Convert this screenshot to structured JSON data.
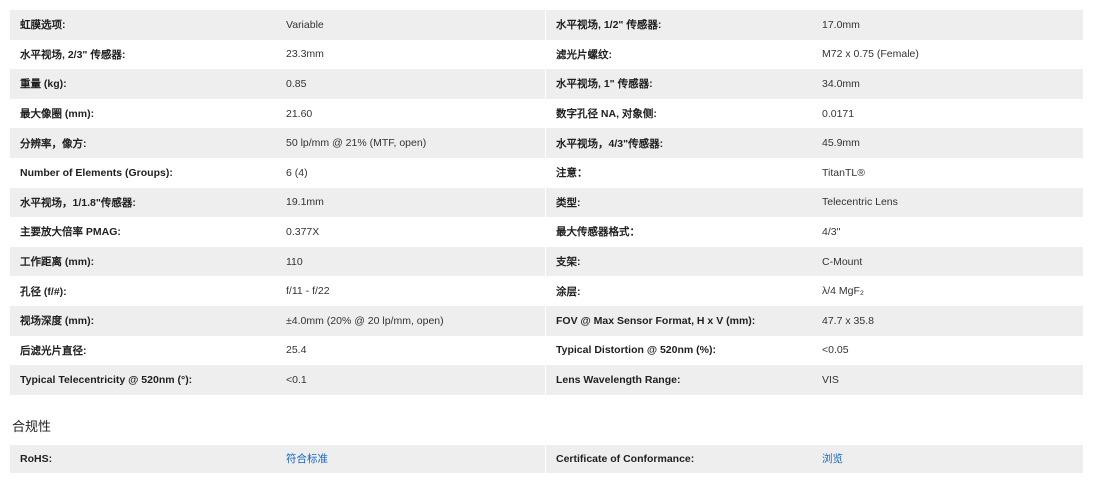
{
  "specs_left": [
    {
      "label": "虹膜选项:",
      "value": "Variable"
    },
    {
      "label": "水平视场, 2/3\" 传感器:",
      "value": "23.3mm"
    },
    {
      "label": "重量 (kg):",
      "value": "0.85"
    },
    {
      "label": "最大像圈 (mm):",
      "value": "21.60"
    },
    {
      "label": "分辨率，像方:",
      "value": "50 lp/mm @ 21% (MTF, open)"
    },
    {
      "label": "Number of Elements (Groups):",
      "value": "6 (4)"
    },
    {
      "label": "水平视场，1/1.8\"传感器:",
      "value": "19.1mm"
    },
    {
      "label": "主要放大倍率 PMAG:",
      "value": "0.377X"
    },
    {
      "label": "工作距离 (mm):",
      "value": "110"
    },
    {
      "label": "孔径 (f/#):",
      "value": "f/11 - f/22"
    },
    {
      "label": "视场深度 (mm):",
      "value": "±4.0mm (20% @ 20 lp/mm, open)"
    },
    {
      "label": "后滤光片直径:",
      "value": "25.4"
    },
    {
      "label": "Typical Telecentricity @ 520nm (°):",
      "value": "<0.1"
    }
  ],
  "specs_right": [
    {
      "label": "水平视场, 1/2\" 传感器:",
      "value": "17.0mm"
    },
    {
      "label": "滤光片螺纹:",
      "value": "M72 x 0.75 (Female)"
    },
    {
      "label": "水平视场, 1\" 传感器:",
      "value": "34.0mm"
    },
    {
      "label": "数字孔径 NA, 对象侧:",
      "value": "0.0171"
    },
    {
      "label": "水平视场，4/3\"传感器:",
      "value": "45.9mm"
    },
    {
      "label": "注意：",
      "value": "TitanTL®"
    },
    {
      "label": "类型:",
      "value": "Telecentric Lens"
    },
    {
      "label": "最大传感器格式：",
      "value": "4/3\""
    },
    {
      "label": "支架:",
      "value": "C-Mount"
    },
    {
      "label": "涂层:",
      "value": "λ/4 MgF₂"
    },
    {
      "label": "FOV @ Max Sensor Format, H x V (mm):",
      "value": "47.7 x 35.8"
    },
    {
      "label": "Typical Distortion @ 520nm (%):",
      "value": "<0.05"
    },
    {
      "label": "Lens Wavelength Range:",
      "value": "VIS"
    }
  ],
  "compliance": {
    "title": "合规性",
    "left": {
      "label": "RoHS:",
      "value": "符合标准"
    },
    "right": {
      "label": "Certificate of Conformance:",
      "value": "浏览"
    }
  },
  "colors": {
    "row_shade": "#eeeeee",
    "link": "#1565c0"
  }
}
